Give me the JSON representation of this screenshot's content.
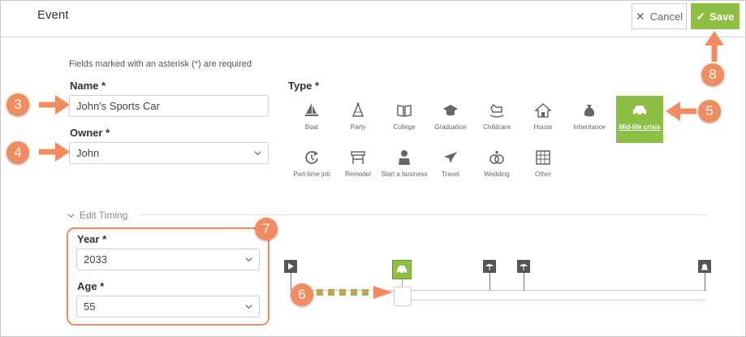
{
  "header": {
    "title": "Event",
    "cancel_label": "Cancel",
    "save_label": "Save"
  },
  "form": {
    "required_note": "Fields marked with an asterisk (*) are required",
    "name_label": "Name *",
    "name_value": "John's Sports Car",
    "owner_label": "Owner *",
    "owner_value": "John",
    "type_label": "Type *"
  },
  "types": [
    {
      "label": "Boat",
      "icon": "sailboat-icon",
      "selected": false
    },
    {
      "label": "Party",
      "icon": "party-hat-icon",
      "selected": false
    },
    {
      "label": "College",
      "icon": "open-book-icon",
      "selected": false
    },
    {
      "label": "Graduation",
      "icon": "graduation-cap-icon",
      "selected": false
    },
    {
      "label": "Childcare",
      "icon": "rocking-horse-icon",
      "selected": false
    },
    {
      "label": "House",
      "icon": "house-icon",
      "selected": false
    },
    {
      "label": "Inheritance",
      "icon": "money-bag-icon",
      "selected": false
    },
    {
      "label": "Mid-life crisis",
      "icon": "car-icon",
      "selected": true
    },
    {
      "label": "Part-time job",
      "icon": "part-time-clock-icon",
      "selected": false
    },
    {
      "label": "Remodel",
      "icon": "remodel-icon",
      "selected": false
    },
    {
      "label": "Start a business",
      "icon": "businessperson-icon",
      "selected": false
    },
    {
      "label": "Travel",
      "icon": "airplane-icon",
      "selected": false
    },
    {
      "label": "Wedding",
      "icon": "rings-icon",
      "selected": false
    },
    {
      "label": "Other",
      "icon": "grid-icon",
      "selected": false
    }
  ],
  "timing": {
    "section_label": "Edit Timing",
    "year_label": "Year *",
    "year_value": "2033",
    "age_label": "Age *",
    "age_value": "55"
  },
  "callouts": [
    "3",
    "4",
    "5",
    "6",
    "7",
    "8"
  ],
  "colors": {
    "accent_green": "#8dbf45",
    "callout_orange": "#f28c5f"
  }
}
